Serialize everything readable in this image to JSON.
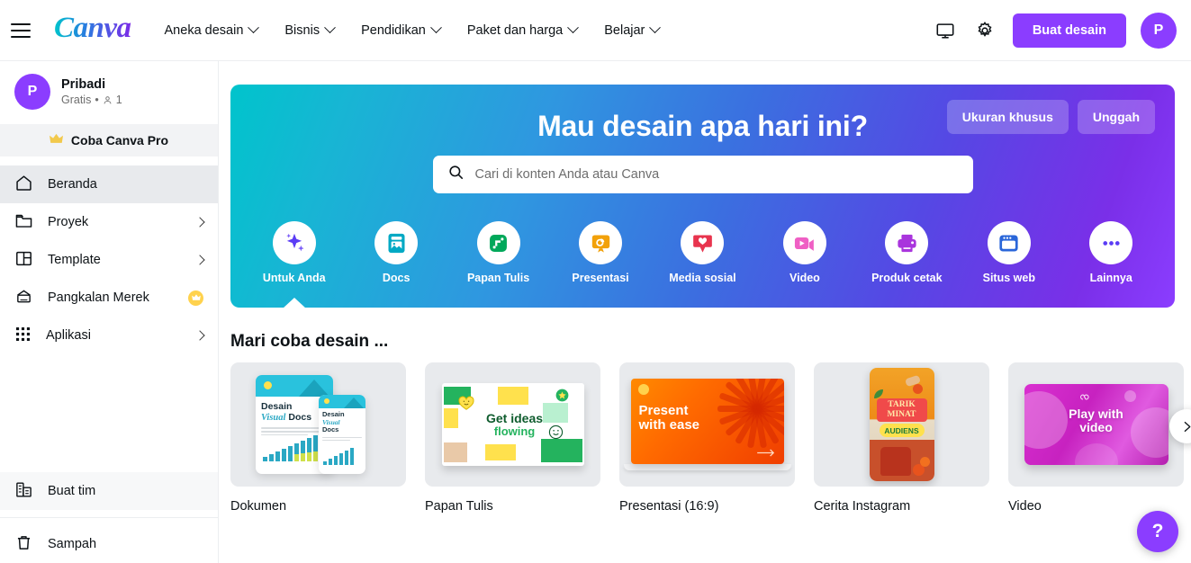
{
  "topnav": {
    "menu_icon": "hamburger-icon",
    "logo": "Canva",
    "items": [
      {
        "label": "Aneka desain",
        "has_caret": true
      },
      {
        "label": "Bisnis",
        "has_caret": true
      },
      {
        "label": "Pendidikan",
        "has_caret": true
      },
      {
        "label": "Paket dan harga",
        "has_caret": true
      },
      {
        "label": "Belajar",
        "has_caret": true
      }
    ],
    "monitor_icon": "monitor-icon",
    "gear_icon": "gear-icon",
    "create_button": "Buat desain",
    "avatar_initial": "P"
  },
  "sidebar": {
    "profile": {
      "avatar_initial": "P",
      "name": "Pribadi",
      "plan": "Gratis",
      "separator": "•",
      "member_count": "1"
    },
    "pro_cta": {
      "icon": "crown-icon",
      "label": "Coba Canva Pro"
    },
    "items": [
      {
        "label": "Beranda",
        "icon": "home-icon",
        "active": true,
        "chevron": false
      },
      {
        "label": "Proyek",
        "icon": "folder-icon",
        "active": false,
        "chevron": true
      },
      {
        "label": "Template",
        "icon": "template-icon",
        "active": false,
        "chevron": true
      },
      {
        "label": "Pangkalan Merek",
        "icon": "brand-kit-icon",
        "active": false,
        "chevron": false,
        "badge": "crown-badge"
      },
      {
        "label": "Aplikasi",
        "icon": "apps-grid-icon",
        "active": false,
        "chevron": true
      }
    ],
    "bottom_items": [
      {
        "label": "Buat tim",
        "icon": "team-building-icon"
      },
      {
        "label": "Sampah",
        "icon": "trash-icon"
      }
    ]
  },
  "hero": {
    "title": "Mau desain apa hari ini?",
    "buttons": [
      {
        "label": "Ukuran khusus",
        "name": "custom-size-button"
      },
      {
        "label": "Unggah",
        "name": "upload-button"
      }
    ],
    "search": {
      "placeholder": "Cari di konten Anda atau Canva",
      "value": "",
      "icon": "search-icon"
    },
    "categories": [
      {
        "label": "Untuk Anda",
        "icon": "sparkle-icon",
        "color": "#5b3df5",
        "active": true
      },
      {
        "label": "Docs",
        "icon": "doc-icon",
        "color": "#00a9c4",
        "active": false
      },
      {
        "label": "Papan Tulis",
        "icon": "whiteboard-icon",
        "color": "#00a85a",
        "active": false
      },
      {
        "label": "Presentasi",
        "icon": "presentation-icon",
        "color": "#f2a10a",
        "active": false
      },
      {
        "label": "Media sosial",
        "icon": "heart-bubble-icon",
        "color": "#e8344e",
        "active": false
      },
      {
        "label": "Video",
        "icon": "video-camera-icon",
        "color": "#ef5fc4",
        "active": false
      },
      {
        "label": "Produk cetak",
        "icon": "printer-icon",
        "color": "#a935dd",
        "active": false
      },
      {
        "label": "Situs web",
        "icon": "browser-window-icon",
        "color": "#2a66d9",
        "active": false
      },
      {
        "label": "Lainnya",
        "icon": "ellipsis-icon",
        "color": "#5b3df5",
        "active": false
      }
    ]
  },
  "section": {
    "title": "Mari coba desain ...",
    "next_arrow": "chevron-right-icon",
    "cards": [
      {
        "label": "Dokumen",
        "art": "document",
        "art_text_1": "Desain",
        "art_text_2": "Visual",
        "art_text_3": "Docs"
      },
      {
        "label": "Papan Tulis",
        "art": "whiteboard",
        "art_text_1": "Get ideas",
        "art_text_2": "flowing"
      },
      {
        "label": "Presentasi (16:9)",
        "art": "presentation",
        "art_text_1": "Present",
        "art_text_2": "with ease"
      },
      {
        "label": "Cerita Instagram",
        "art": "instagram",
        "art_text_1": "TARIK",
        "art_text_2": "MINAT",
        "art_text_3": "AUDIENS"
      },
      {
        "label": "Video",
        "art": "video",
        "art_text_1": "Play with",
        "art_text_2": "video"
      }
    ]
  },
  "help": {
    "label": "?"
  }
}
